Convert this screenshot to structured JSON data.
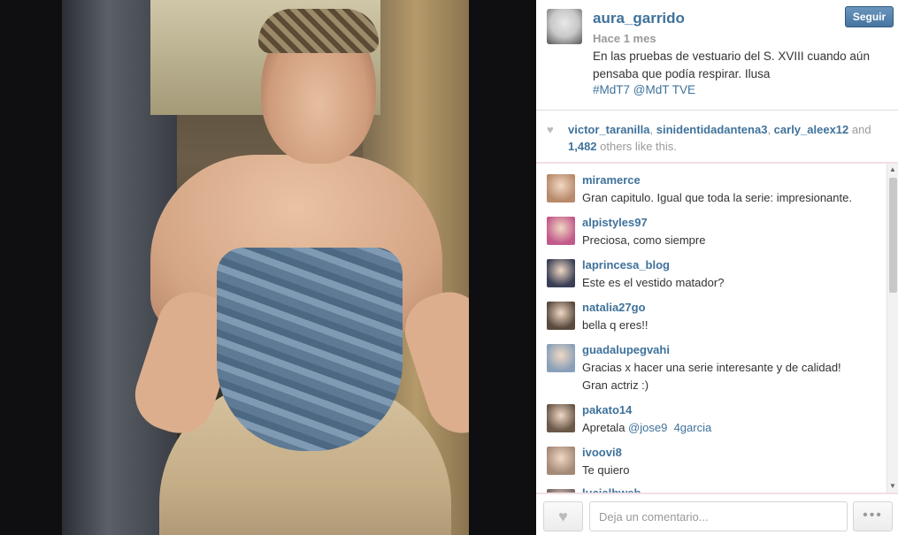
{
  "post": {
    "username": "aura_garrido",
    "time": "Hace 1 mes",
    "caption_line1": "En las pruebas de vestuario del S. XVIII cuando aún",
    "caption_line2": "pensaba que podía respirar. Ilusa",
    "hashtags": "#MdT7 @MdT  TVE",
    "follow_label": "Seguir"
  },
  "likes": {
    "user1": "victor_taranilla",
    "user2": "sinidentidadantena3",
    "user3": "carly_aleex12",
    "and_text": "and",
    "count": "1,482",
    "others_text": "others like this."
  },
  "comments": [
    {
      "user": "miramerce",
      "text": "Gran capitulo. Igual que toda la serie: impresionante.",
      "avatar_color": "#b88a6a"
    },
    {
      "user": "alpistyles97",
      "text": "Preciosa, como siempre",
      "avatar_color": "#c25a8a"
    },
    {
      "user": "laprincesa_blog",
      "text": "Este es el vestido matador?",
      "avatar_color": "#3a3f55"
    },
    {
      "user": "natalia27go",
      "text": "bella q eres!!",
      "avatar_color": "#5a4a3e"
    },
    {
      "user": "guadalupegvahi",
      "text_line1": "Gracias x hacer una serie interesante y de calidad!",
      "text_line2": "Gran actriz :)",
      "avatar_color": "#8aa0b8"
    },
    {
      "user": "pakato14",
      "text_prefix": "Apretala",
      "mention1": "@jose9",
      "mention2": "4garcia",
      "avatar_color": "#6a5848"
    },
    {
      "user": "ivoovi8",
      "text": "Te quiero",
      "avatar_color": "#a58a78"
    },
    {
      "user": "lucialbweb",
      "text": "",
      "avatar_color": "#7a6a6a"
    }
  ],
  "composer": {
    "placeholder": "Deja un comentario...",
    "more_label": "•••"
  },
  "icons": {
    "like": "heart-icon",
    "more": "ellipsis-icon",
    "scroll_up": "arrow-up-icon",
    "scroll_down": "arrow-down-icon"
  },
  "colors": {
    "link": "#3f729b",
    "follow_button": "#4775a0",
    "accent_pink": "#f3dfe6"
  }
}
